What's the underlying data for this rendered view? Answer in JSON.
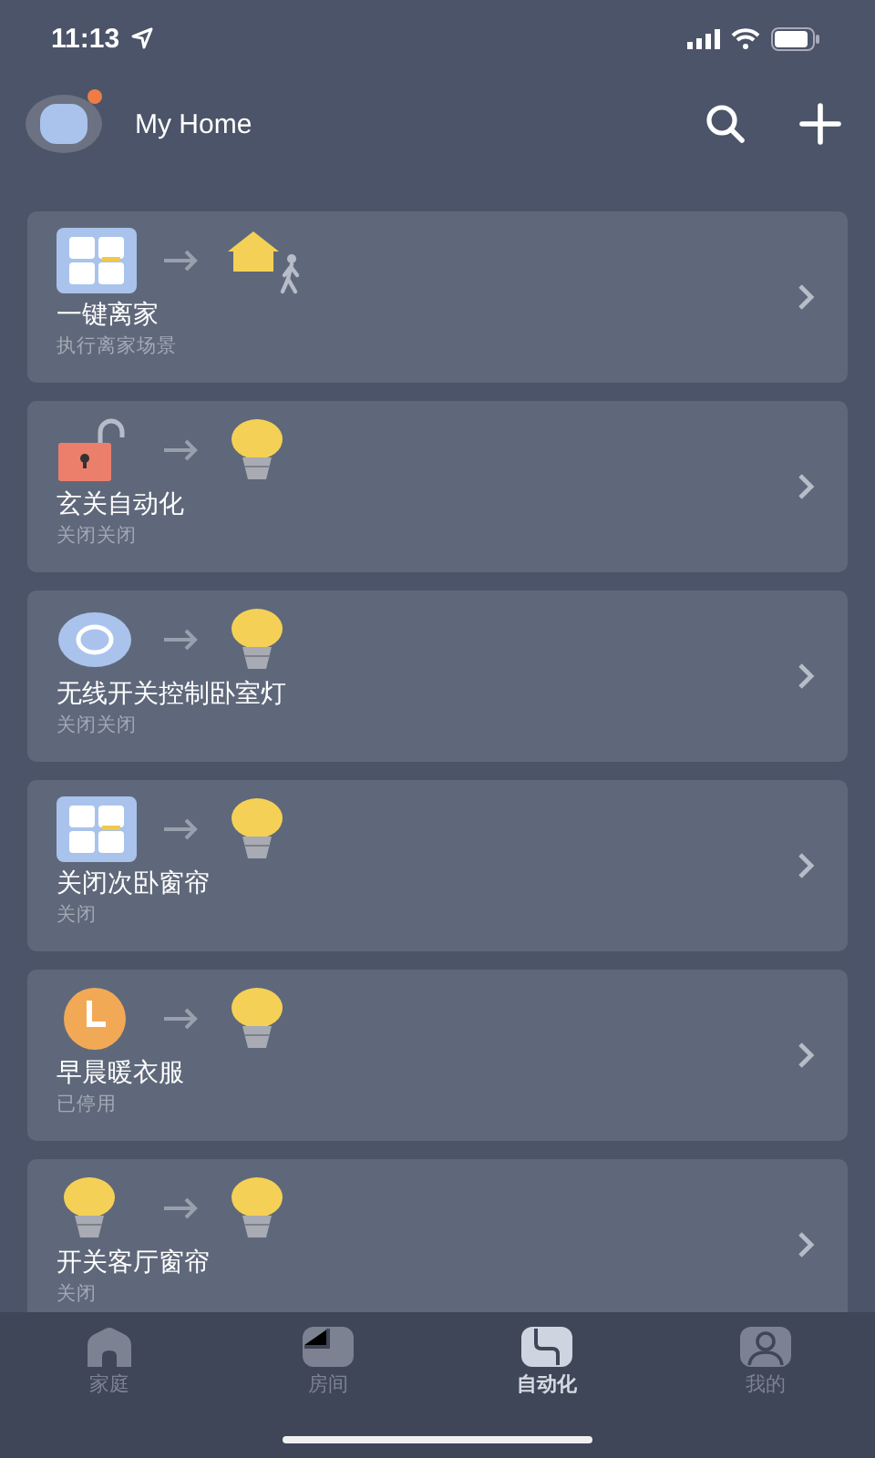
{
  "status_bar": {
    "time": "11:13"
  },
  "header": {
    "title": "My Home",
    "notification": true
  },
  "automations": [
    {
      "trigger": {
        "kind": "curtain"
      },
      "action": {
        "kind": "home"
      },
      "title": "一键离家",
      "subtitle": "执行离家场景"
    },
    {
      "trigger": {
        "kind": "lock"
      },
      "action": {
        "kind": "bulb"
      },
      "title": "玄关自动化",
      "subtitle": "关闭关闭"
    },
    {
      "trigger": {
        "kind": "switch"
      },
      "action": {
        "kind": "bulb"
      },
      "title": "无线开关控制卧室灯",
      "subtitle": "关闭关闭"
    },
    {
      "trigger": {
        "kind": "curtain"
      },
      "action": {
        "kind": "bulb"
      },
      "title": "关闭次卧窗帘",
      "subtitle": "关闭"
    },
    {
      "trigger": {
        "kind": "clock"
      },
      "action": {
        "kind": "bulb"
      },
      "title": "早晨暖衣服",
      "subtitle": "已停用"
    },
    {
      "trigger": {
        "kind": "bulb"
      },
      "action": {
        "kind": "bulb"
      },
      "title": "开关客厅窗帘",
      "subtitle": "关闭"
    }
  ],
  "tabs": [
    {
      "label": "家庭",
      "selected": false
    },
    {
      "label": "房间",
      "selected": false
    },
    {
      "label": "自动化",
      "selected": true
    },
    {
      "label": "我的",
      "selected": false
    }
  ]
}
